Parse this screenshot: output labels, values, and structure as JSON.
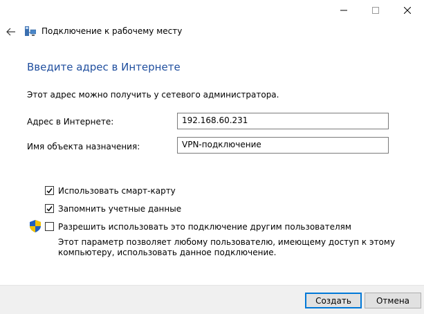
{
  "window": {
    "title": "Подключение к рабочему месту",
    "minimize_glyph": "—",
    "maximize_glyph": "☐",
    "close_glyph": "✕"
  },
  "heading": "Введите адрес в Интернете",
  "hint": "Этот адрес можно получить у сетевого администратора.",
  "fields": {
    "address_label": "Адрес в Интернете:",
    "address_value": "192.168.60.231",
    "dest_label": "Имя объекта назначения:",
    "dest_value": "VPN-подключение"
  },
  "options": {
    "smartcard_label": "Использовать смарт-карту",
    "smartcard_checked": true,
    "remember_label": "Запомнить учетные данные",
    "remember_checked": true,
    "share_label": "Разрешить использовать это подключение другим пользователям",
    "share_checked": false,
    "share_desc_line1": "Этот параметр позволяет любому пользователю, имеющему доступ к этому",
    "share_desc_line2": "компьютеру, использовать данное подключение."
  },
  "buttons": {
    "create": "Создать",
    "cancel": "Отмена"
  },
  "icons": {
    "back": "arrow-left-icon",
    "app": "network-connection-icon",
    "shield": "uac-shield-icon"
  },
  "colors": {
    "heading": "#1f4e9e",
    "accent": "#0078d7"
  }
}
